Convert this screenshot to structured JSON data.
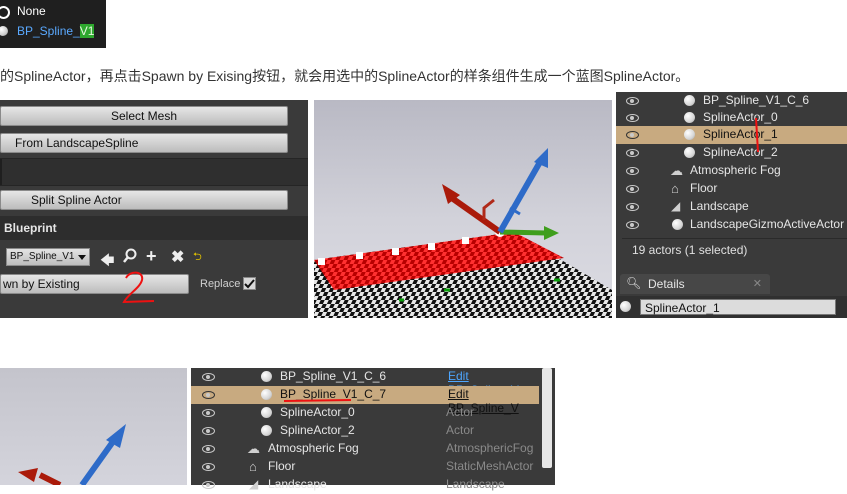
{
  "dropdown_popup": {
    "none_label": "None",
    "selected_label_prefix": "BP_Spline_",
    "selected_label_highlight": "V1"
  },
  "description_text": "的SplineActor，再点击Spawn by Exising按钮，就会用选中的SplineActor的样条组件生成一个蓝图SplineActor。",
  "left_panel": {
    "select_mesh": "Select Mesh",
    "from_landscape_spline": "From LandscapeSpline",
    "split_spline_actor": "Split Spline Actor",
    "blueprint_header": "Blueprint",
    "blueprint_select": "BP_Spline_V1",
    "spawn_button": "wn by Existing",
    "replace_label": "Replace"
  },
  "outliner_top": {
    "rows": [
      {
        "label": "BP_Spline_V1_C_6",
        "icon": "sphere-icon"
      },
      {
        "label": "SplineActor_0",
        "icon": "sphere-icon"
      },
      {
        "label": "SplineActor_1",
        "icon": "sphere-icon",
        "selected": true
      },
      {
        "label": "SplineActor_2",
        "icon": "sphere-icon"
      },
      {
        "label": "Atmospheric Fog",
        "icon": "fog-icon"
      },
      {
        "label": "Floor",
        "icon": "floor-icon"
      },
      {
        "label": "Landscape",
        "icon": "landscape-icon"
      },
      {
        "label": "LandscapeGizmoActiveActor",
        "icon": "sphere-icon"
      }
    ],
    "status": "19 actors (1 selected)",
    "details_tab": "Details",
    "details_value": "SplineActor_1"
  },
  "outliner_bottom": {
    "rows": [
      {
        "label": "BP_Spline_V1_C_6",
        "type": "Edit BP_Spline_V",
        "link": true
      },
      {
        "label": "BP_Spline_V1_C_7",
        "type": "Edit BP_Spline_V",
        "link": false,
        "selected": true
      },
      {
        "label": "SplineActor_0",
        "type": "Actor"
      },
      {
        "label": "SplineActor_2",
        "type": "Actor"
      },
      {
        "label": "Atmospheric Fog",
        "type": "AtmosphericFog"
      },
      {
        "label": "Floor",
        "type": "StaticMeshActor"
      },
      {
        "label": "Landscape",
        "type": "Landscape"
      }
    ]
  },
  "colors": {
    "panel_bg": "#3c3c3c",
    "selection": "#c8aa80",
    "link": "#4da6ff",
    "annotation_red": "#e11111",
    "highlight_green": "#2ea82e"
  }
}
